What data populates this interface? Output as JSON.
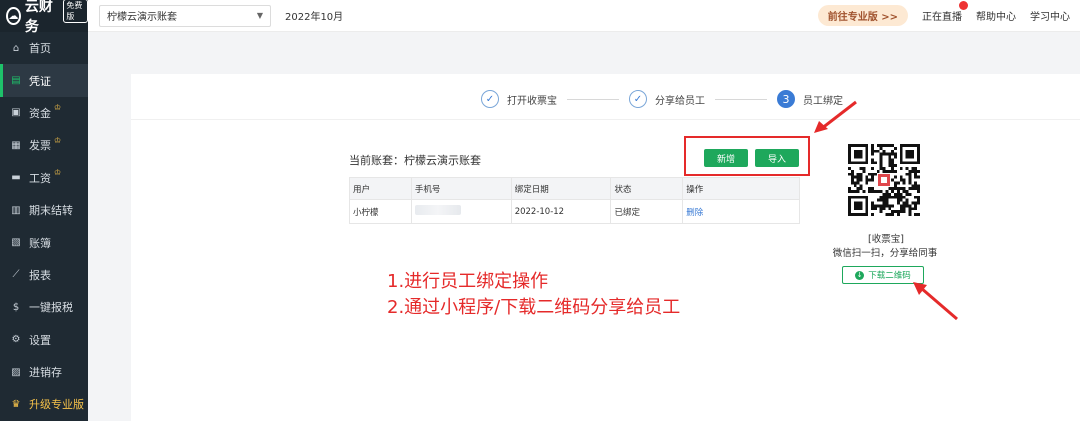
{
  "brand": {
    "name": "云财务",
    "badge": "免费版"
  },
  "sidebar": {
    "items": [
      {
        "label": "首页",
        "icon": "⌂",
        "icon_name": "home-icon"
      },
      {
        "label": "凭证",
        "icon": "▤",
        "icon_name": "voucher-icon",
        "active": true
      },
      {
        "label": "资金",
        "icon": "▣",
        "icon_name": "fund-icon",
        "crown": true
      },
      {
        "label": "发票",
        "icon": "▦",
        "icon_name": "invoice-icon",
        "crown": true
      },
      {
        "label": "工资",
        "icon": "▬",
        "icon_name": "salary-icon",
        "crown": true
      },
      {
        "label": "期末结转",
        "icon": "▥",
        "icon_name": "period-close-icon"
      },
      {
        "label": "账簿",
        "icon": "▧",
        "icon_name": "ledger-icon"
      },
      {
        "label": "报表",
        "icon": "⟋",
        "icon_name": "report-icon"
      },
      {
        "label": "一键报税",
        "icon": "$",
        "icon_name": "tax-icon"
      },
      {
        "label": "设置",
        "icon": "⚙",
        "icon_name": "settings-icon"
      },
      {
        "label": "进销存",
        "icon": "▨",
        "icon_name": "inventory-icon"
      },
      {
        "label": "升级专业版",
        "icon": "♛",
        "icon_name": "crown-icon",
        "upgrade": true
      }
    ]
  },
  "topbar": {
    "account": "柠檬云演示账套",
    "period": "2022年10月",
    "pro_button": "前往专业版 >>",
    "live": "正在直播",
    "help": "帮助中心",
    "learn": "学习中心"
  },
  "steps": [
    {
      "label": "打开收票宝",
      "mark": "✓"
    },
    {
      "label": "分享给员工",
      "mark": "✓"
    },
    {
      "label": "员工绑定",
      "mark": "3",
      "current": true
    }
  ],
  "main": {
    "account_label": "当前账套：柠檬云演示账套",
    "add_label": "新增",
    "import_label": "导入",
    "table": {
      "headers": [
        "用户",
        "手机号",
        "绑定日期",
        "状态",
        "操作"
      ],
      "rows": [
        {
          "user": "小柠檬",
          "phone": "",
          "date": "2022-10-12",
          "status": "已绑定",
          "action": "删除"
        }
      ]
    },
    "qr": {
      "caption1": "[收票宝]",
      "caption2": "微信扫一扫，分享给同事",
      "download_label": "下载二维码"
    },
    "note_line1": "1.进行员工绑定操作",
    "note_line2": "2.通过小程序/下载二维码分享给员工"
  },
  "colors": {
    "accent_green": "#1ea85c",
    "annotation_red": "#e52a2a",
    "sidebar_bg": "#1f2a33",
    "step_blue": "#3a7bd5"
  }
}
